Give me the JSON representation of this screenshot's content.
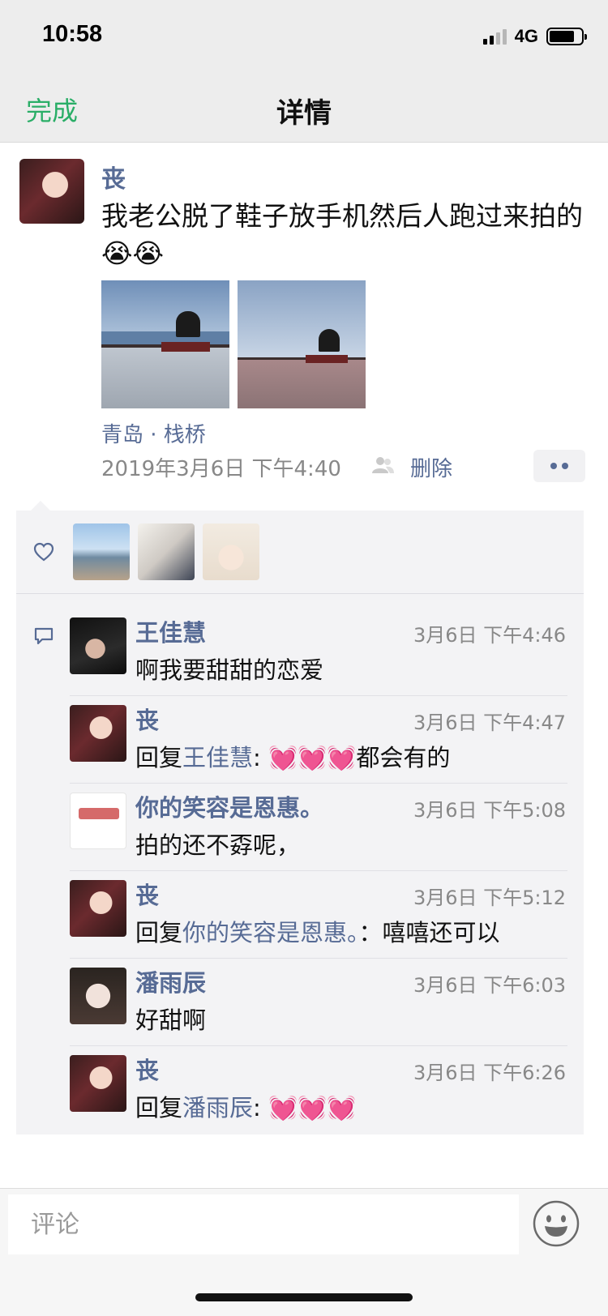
{
  "status_bar": {
    "time": "10:58",
    "network": "4G"
  },
  "nav": {
    "done_label": "完成",
    "title": "详情"
  },
  "post": {
    "author": "丧",
    "text": "我老公脱了鞋子放手机然后人跑过来拍的😭😭",
    "location": "青岛 · 栈桥",
    "time": "2019年3月6日 下午4:40",
    "delete_label": "删除"
  },
  "comments": [
    {
      "name": "王佳慧",
      "time": "3月6日 下午4:46",
      "text": "啊我要甜甜的恋爱"
    },
    {
      "name": "丧",
      "time": "3月6日 下午4:47",
      "prefix": "回复",
      "reply_to": "王佳慧",
      "suffix": ": 💓💓💓都会有的"
    },
    {
      "name": "你的笑容是恩惠。",
      "time": "3月6日 下午5:08",
      "text": "拍的还不孬呢，"
    },
    {
      "name": "丧",
      "time": "3月6日 下午5:12",
      "prefix": "回复",
      "reply_to": "你的笑容是恩惠。",
      "suffix": "：嘻嘻还可以"
    },
    {
      "name": "潘雨辰",
      "time": "3月6日 下午6:03",
      "text": "好甜啊"
    },
    {
      "name": "丧",
      "time": "3月6日 下午6:26",
      "prefix": "回复",
      "reply_to": "潘雨辰",
      "suffix": ": 💓💓💓"
    }
  ],
  "input": {
    "placeholder": "评论"
  },
  "icons": {
    "heart": "heart-icon",
    "comment": "comment-icon",
    "friends": "friends-icon",
    "emoji": "emoji-icon",
    "more": "more-dots-icon"
  },
  "colors": {
    "link": "#576b95",
    "accent_green": "#2aae67",
    "panel_bg": "#f3f3f5"
  }
}
